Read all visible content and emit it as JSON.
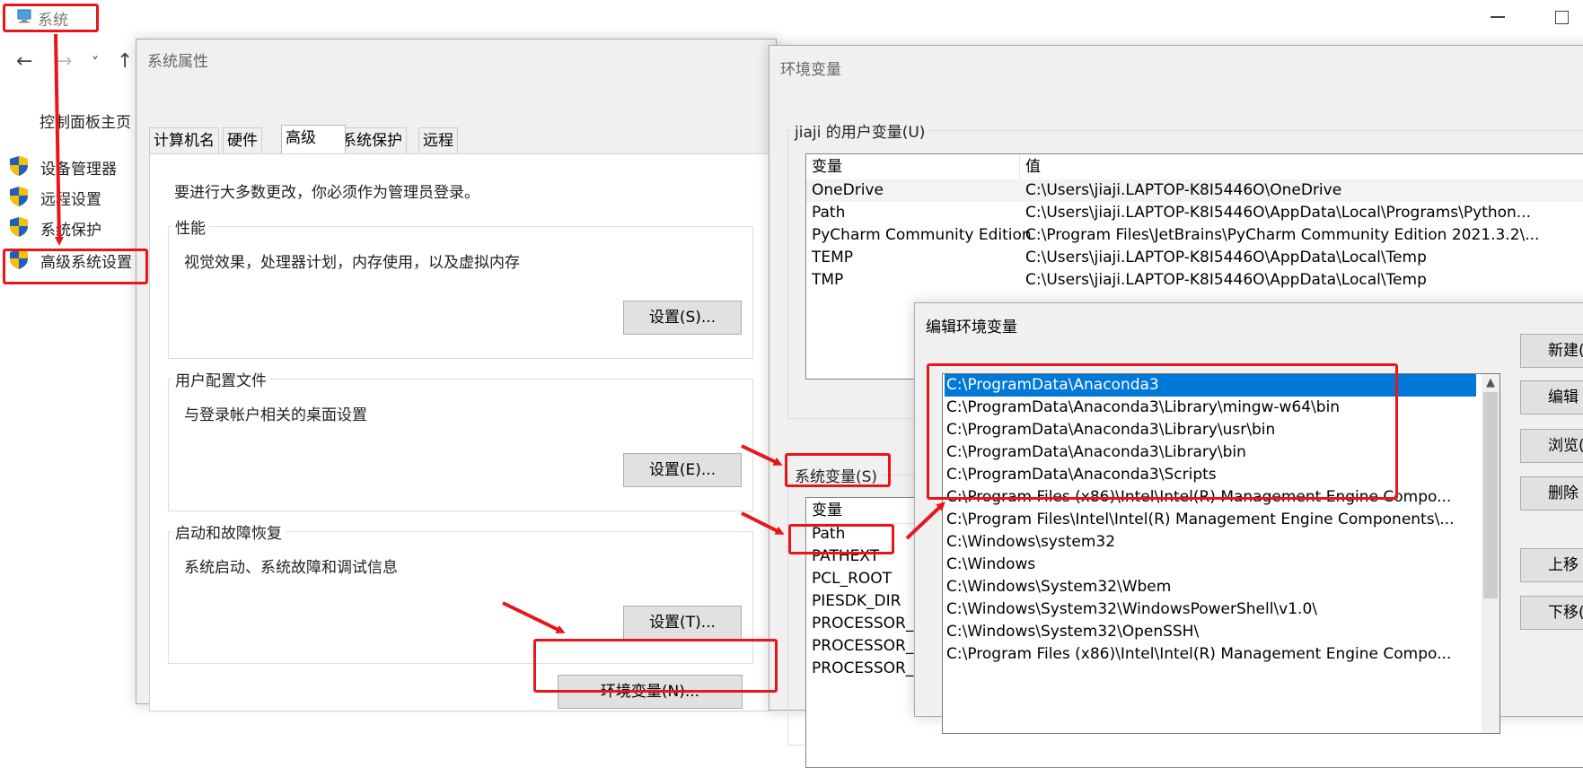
{
  "system_window": {
    "title": "系统",
    "nav": {
      "back": "←",
      "forward": "→",
      "recent": "˅",
      "up": "↑"
    },
    "control_panel_home": "控制面板主页",
    "sidebar": [
      {
        "label": "设备管理器",
        "icon": "uac-shield-icon"
      },
      {
        "label": "远程设置",
        "icon": "uac-shield-icon"
      },
      {
        "label": "系统保护",
        "icon": "uac-shield-icon"
      },
      {
        "label": "高级系统设置",
        "icon": "uac-shield-icon"
      }
    ]
  },
  "system_properties": {
    "title": "系统属性",
    "tabs": [
      "计算机名",
      "硬件",
      "高级",
      "系统保护",
      "远程"
    ],
    "active_tab": "高级",
    "admin_note": "要进行大多数更改，你必须作为管理员登录。",
    "performance": {
      "label": "性能",
      "desc": "视觉效果，处理器计划，内存使用，以及虚拟内存",
      "button": "设置(S)..."
    },
    "user_profiles": {
      "label": "用户配置文件",
      "desc": "与登录帐户相关的桌面设置",
      "button": "设置(E)..."
    },
    "startup_recovery": {
      "label": "启动和故障恢复",
      "desc": "系统启动、系统故障和调试信息",
      "button": "设置(T)..."
    },
    "env_button": "环境变量(N)..."
  },
  "env_vars": {
    "title": "环境变量",
    "user_section": "jiaji 的用户变量(U)",
    "columns": {
      "name": "变量",
      "value": "值"
    },
    "user_vars": [
      {
        "name": "OneDrive",
        "value": "C:\\Users\\jiaji.LAPTOP-K8I5446O\\OneDrive"
      },
      {
        "name": "Path",
        "value": "C:\\Users\\jiaji.LAPTOP-K8I5446O\\AppData\\Local\\Programs\\Python..."
      },
      {
        "name": "PyCharm Community Edition",
        "value": "C:\\Program Files\\JetBrains\\PyCharm Community Edition 2021.3.2\\..."
      },
      {
        "name": "TEMP",
        "value": "C:\\Users\\jiaji.LAPTOP-K8I5446O\\AppData\\Local\\Temp"
      },
      {
        "name": "TMP",
        "value": "C:\\Users\\jiaji.LAPTOP-K8I5446O\\AppData\\Local\\Temp"
      }
    ],
    "system_section": "系统变量(S)",
    "system_vars": [
      "Path",
      "PATHEXT",
      "PCL_ROOT",
      "PIESDK_DIR",
      "PROCESSOR_",
      "PROCESSOR_",
      "PROCESSOR_"
    ]
  },
  "edit_env": {
    "title": "编辑环境变量",
    "entries": [
      "C:\\ProgramData\\Anaconda3",
      "C:\\ProgramData\\Anaconda3\\Library\\mingw-w64\\bin",
      "C:\\ProgramData\\Anaconda3\\Library\\usr\\bin",
      "C:\\ProgramData\\Anaconda3\\Library\\bin",
      "C:\\ProgramData\\Anaconda3\\Scripts",
      "C:\\Program Files (x86)\\Intel\\Intel(R) Management Engine Compo...",
      "C:\\Program Files\\Intel\\Intel(R) Management Engine Components\\...",
      "C:\\Windows\\system32",
      "C:\\Windows",
      "C:\\Windows\\System32\\Wbem",
      "C:\\Windows\\System32\\WindowsPowerShell\\v1.0\\",
      "C:\\Windows\\System32\\OpenSSH\\",
      "C:\\Program Files (x86)\\Intel\\Intel(R) Management Engine Compo..."
    ],
    "selected_index": 0,
    "buttons": [
      "新建(",
      "编辑",
      "浏览(",
      "删除",
      "上移",
      "下移("
    ]
  },
  "colors": {
    "annotation": "#e8161b",
    "selection": "#0078d7",
    "shield_blue": "#1f5fbf",
    "shield_yellow": "#f5c000"
  }
}
